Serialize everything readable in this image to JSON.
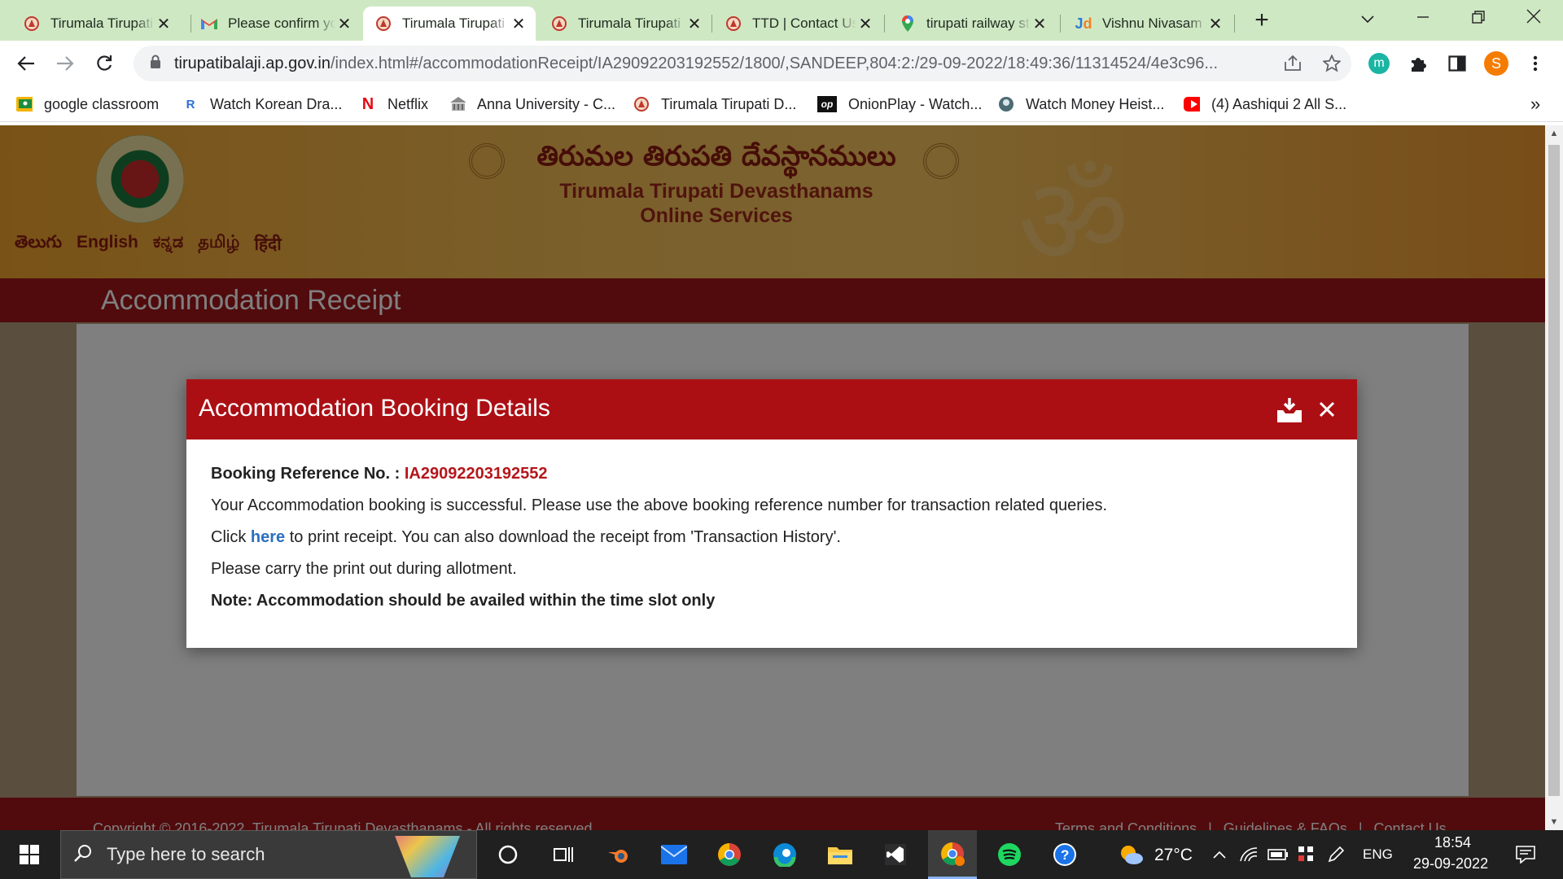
{
  "browser": {
    "tabs": [
      {
        "title": "Tirumala Tirupati Devasthanams",
        "icon": "ttd-favicon",
        "active": false
      },
      {
        "title": "Please confirm your email",
        "icon": "gmail-favicon",
        "active": false
      },
      {
        "title": "Tirumala Tirupati Devasthanams",
        "icon": "ttd-favicon",
        "active": true
      },
      {
        "title": "Tirumala Tirupati Devasthanams",
        "icon": "ttd-favicon",
        "active": false
      },
      {
        "title": "TTD | Contact Us",
        "icon": "ttd-favicon",
        "active": false
      },
      {
        "title": "tirupati railway station",
        "icon": "maps-pin-favicon",
        "active": false
      },
      {
        "title": "Vishnu Nivasam",
        "icon": "justdial-favicon",
        "active": false
      }
    ],
    "new_tab_symbol": "+",
    "url_host": "tirupatibalaji.ap.gov.in",
    "url_rest": "/index.html#/accommodationReceipt/IA29092203192552/1800/,SANDEEP,804:2:/29-09-2022/18:49:36/11314524/4e3c96...",
    "profile_letter": "S",
    "extension_letter": "m",
    "bookmarks": [
      {
        "label": "google classroom",
        "icon": "classroom-icon"
      },
      {
        "label": "Watch Korean Dra...",
        "icon": "r-icon"
      },
      {
        "label": "Netflix",
        "icon": "netflix-icon"
      },
      {
        "label": "Anna University - C...",
        "icon": "anna-univ-icon"
      },
      {
        "label": "Tirumala Tirupati D...",
        "icon": "ttd-favicon"
      },
      {
        "label": "OnionPlay - Watch...",
        "icon": "onionplay-icon"
      },
      {
        "label": "Watch Money Heist...",
        "icon": "money-heist-icon"
      },
      {
        "label": "(4) Aashiqui 2 All S...",
        "icon": "youtube-icon"
      }
    ],
    "bookmarks_overflow": "»"
  },
  "site": {
    "telugu_title": "తిరుమల తిరుపతి దేవస్థానములు",
    "org_line1": "Tirumala Tirupati Devasthanams",
    "org_line2": "Online Services",
    "languages": [
      "తెలుగు",
      "English",
      "ಕನ್ನಡ",
      "தமிழ்",
      "हिंदी"
    ],
    "page_title": "Accommodation Receipt",
    "footer_copyright": "Copyright © 2016-2022. Tirumala Tirupati Devasthanams - All rights reserved",
    "footer_links": [
      "Terms and Conditions",
      "|",
      "Guidelines & FAQs",
      "|",
      "Contact Us"
    ]
  },
  "modal": {
    "title": "Accommodation Booking Details",
    "ref_label": "Booking Reference No. :",
    "ref_no": "IA29092203192552",
    "line1": "Your Accommodation booking is successful. Please use the above booking reference number for transaction related queries.",
    "line2_pre": "Click",
    "line2_link": "here",
    "line2_post": "to print receipt. You can also download the receipt from 'Transaction History'.",
    "line3": "Please carry the print out during allotment.",
    "note": "Note: Accommodation should be availed within the time slot only"
  },
  "taskbar": {
    "search_placeholder": "Type here to search",
    "weather": "27°C",
    "language": "ENG",
    "time": "18:54",
    "date": "29-09-2022"
  },
  "colors": {
    "modal_header": "#ab0f14",
    "reference_red": "#b5161b",
    "link_blue": "#2a6fc0",
    "tab_strip": "#cfe8c4"
  }
}
